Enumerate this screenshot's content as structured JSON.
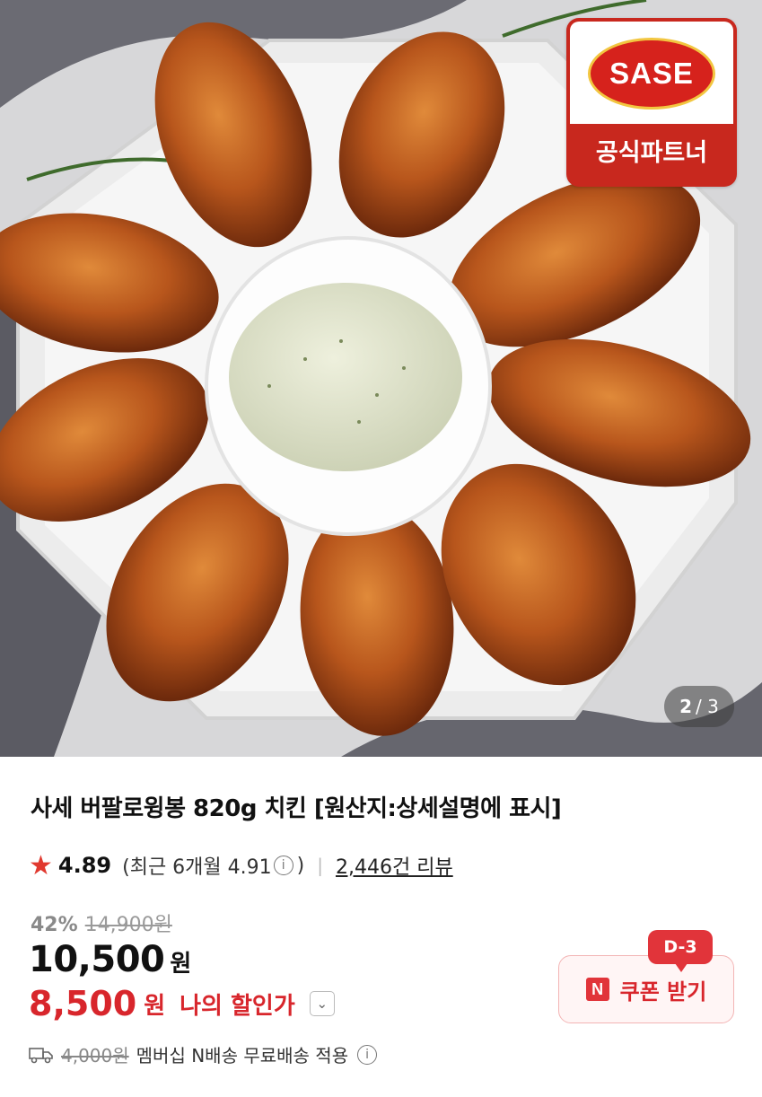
{
  "badge": {
    "logo_text": "SASE",
    "label": "공식파트너"
  },
  "pager": {
    "current": "2",
    "total": "/ 3"
  },
  "product": {
    "title": "사세 버팔로윙봉 820g 치킨 [원산지:상세설명에 표시]"
  },
  "rating": {
    "score": "4.89",
    "recent_open": "(최근 6개월 4.91",
    "recent_close": ")",
    "review_count": "2,446건 리뷰"
  },
  "price": {
    "discount_rate": "42%",
    "original": "14,900원",
    "current": "10,500",
    "current_unit": "원",
    "my_price": "8,500",
    "my_price_unit": "원",
    "my_price_label": "나의 할인가"
  },
  "shipping": {
    "old_fee": "4,000원",
    "text": "멤버십 N배송 무료배송 적용"
  },
  "coupon": {
    "dday": "D-3",
    "logo": "N",
    "label": "쿠폰 받기"
  },
  "colors": {
    "accent_red": "#d8262c",
    "badge_red": "#c8281e"
  },
  "icons": [
    "star-icon",
    "info-icon",
    "chevron-down-icon",
    "truck-icon",
    "n-logo-icon"
  ]
}
